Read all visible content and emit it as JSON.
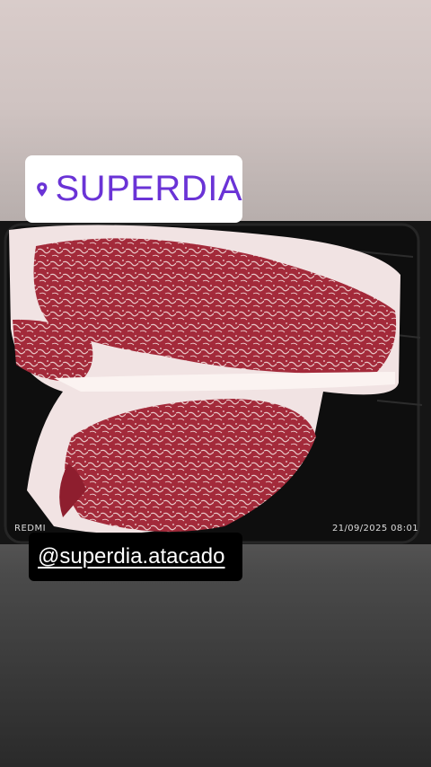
{
  "story": {
    "location_sticker": {
      "icon": "location-pin-icon",
      "text": "SUPERDIA",
      "color": "#6a33d6"
    },
    "mention_sticker": {
      "text": "@superdia.atacado"
    },
    "photo": {
      "watermark_left": "REDMI",
      "watermark_right": "21/09/2025 08:01"
    }
  }
}
